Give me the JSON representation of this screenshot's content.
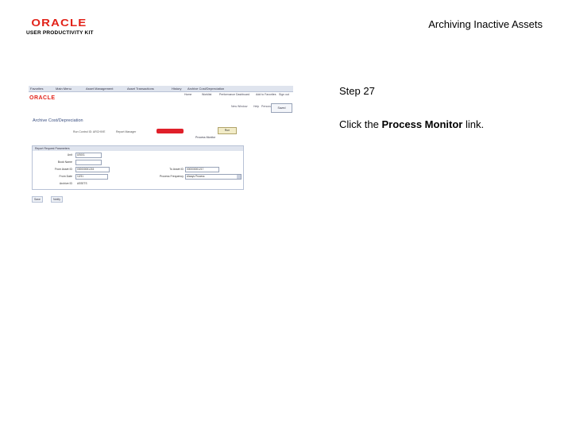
{
  "logo": {
    "line1": "ORACLE",
    "line2": "USER PRODUCTIVITY KIT"
  },
  "header": {
    "title": "Archiving Inactive Assets"
  },
  "step": {
    "label": "Step 27",
    "instruction_prefix": "Click the ",
    "instruction_target": "Process Monitor",
    "instruction_suffix": " link."
  },
  "thumbnail": {
    "breadcrumbs": [
      "Favorites",
      "Main Menu",
      "Asset Management",
      "Asset Transactions",
      "History",
      "Archive Cost/Depreciation"
    ],
    "top_links": [
      "Home",
      "Worklist",
      "Performance Dashboard",
      "Add to Favorites",
      "Sign out"
    ],
    "logo": "ORACLE",
    "subnav": [
      "New Window",
      "Help",
      "Personalize Page"
    ],
    "new_window": "Saved",
    "page_title": "Archive Cost/Depreciation",
    "run_info": [
      "Run Control ID: ARCHIVE",
      "Report Manager"
    ],
    "run_button": "Run",
    "process_monitor": "Process Monitor",
    "panel_title": "Report Request Parameters",
    "fields": {
      "unit_label": "Unit",
      "unit_value": "US001",
      "book_label": "Book Name",
      "book_value": "",
      "from_asset_label": "From Asset ID",
      "from_asset_value": "000000001215",
      "to_asset_label": "To Asset ID",
      "to_asset_value": "000000001217",
      "from_date_label": "From Date",
      "from_date_value": "12/31",
      "process_label": "Process Frequency",
      "process_value": "Always Process",
      "archive_id_label": "Archive ID",
      "archive_id_value": "ASSETS"
    },
    "buttons": [
      "Save",
      "Notify"
    ]
  }
}
